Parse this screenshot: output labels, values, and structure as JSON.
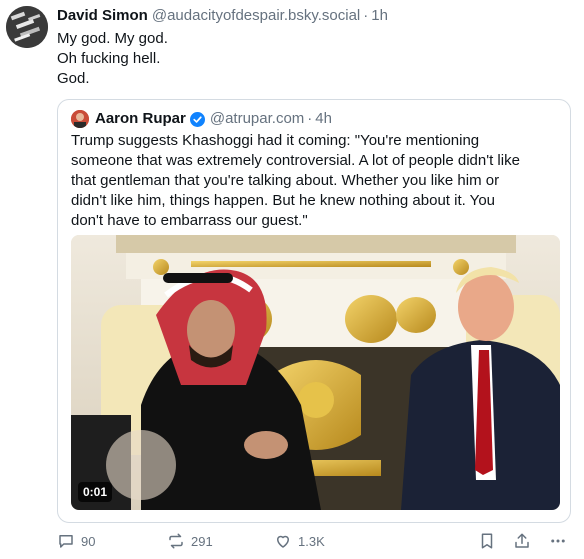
{
  "post": {
    "author_name": "David Simon",
    "author_handle": "@audacityofdespair.bsky.social",
    "separator": "·",
    "time": "1h",
    "lines": [
      "My god. My god.",
      "Oh fucking hell.",
      "God."
    ]
  },
  "quote": {
    "author_name": "Aaron Rupar",
    "author_handle": "@atrupar.com",
    "separator": "·",
    "time": "4h",
    "verified": true,
    "lines": [
      "Trump suggests Khashoggi had it coming: \"You're mentioning",
      "someone that was extremely controversial. A lot of people didn't like",
      "that gentleman that you're talking about. Whether you like him or",
      "didn't like him, things happen. But he knew nothing about it. You",
      "don't have to embarrass our guest.\""
    ],
    "video": {
      "duration": "0:01"
    }
  },
  "actions": {
    "replies": "90",
    "reposts": "291",
    "likes": "1.3K"
  },
  "icons": {
    "reply": "speech-bubble-icon",
    "repost": "repost-arrows-icon",
    "like": "heart-icon",
    "bookmark": "bookmark-icon",
    "share": "share-icon",
    "more": "more-dots-icon"
  },
  "colors": {
    "text_primary": "#0f1419",
    "text_secondary": "#66727f",
    "border": "#d4dbe2",
    "verified": "#1083fe"
  }
}
